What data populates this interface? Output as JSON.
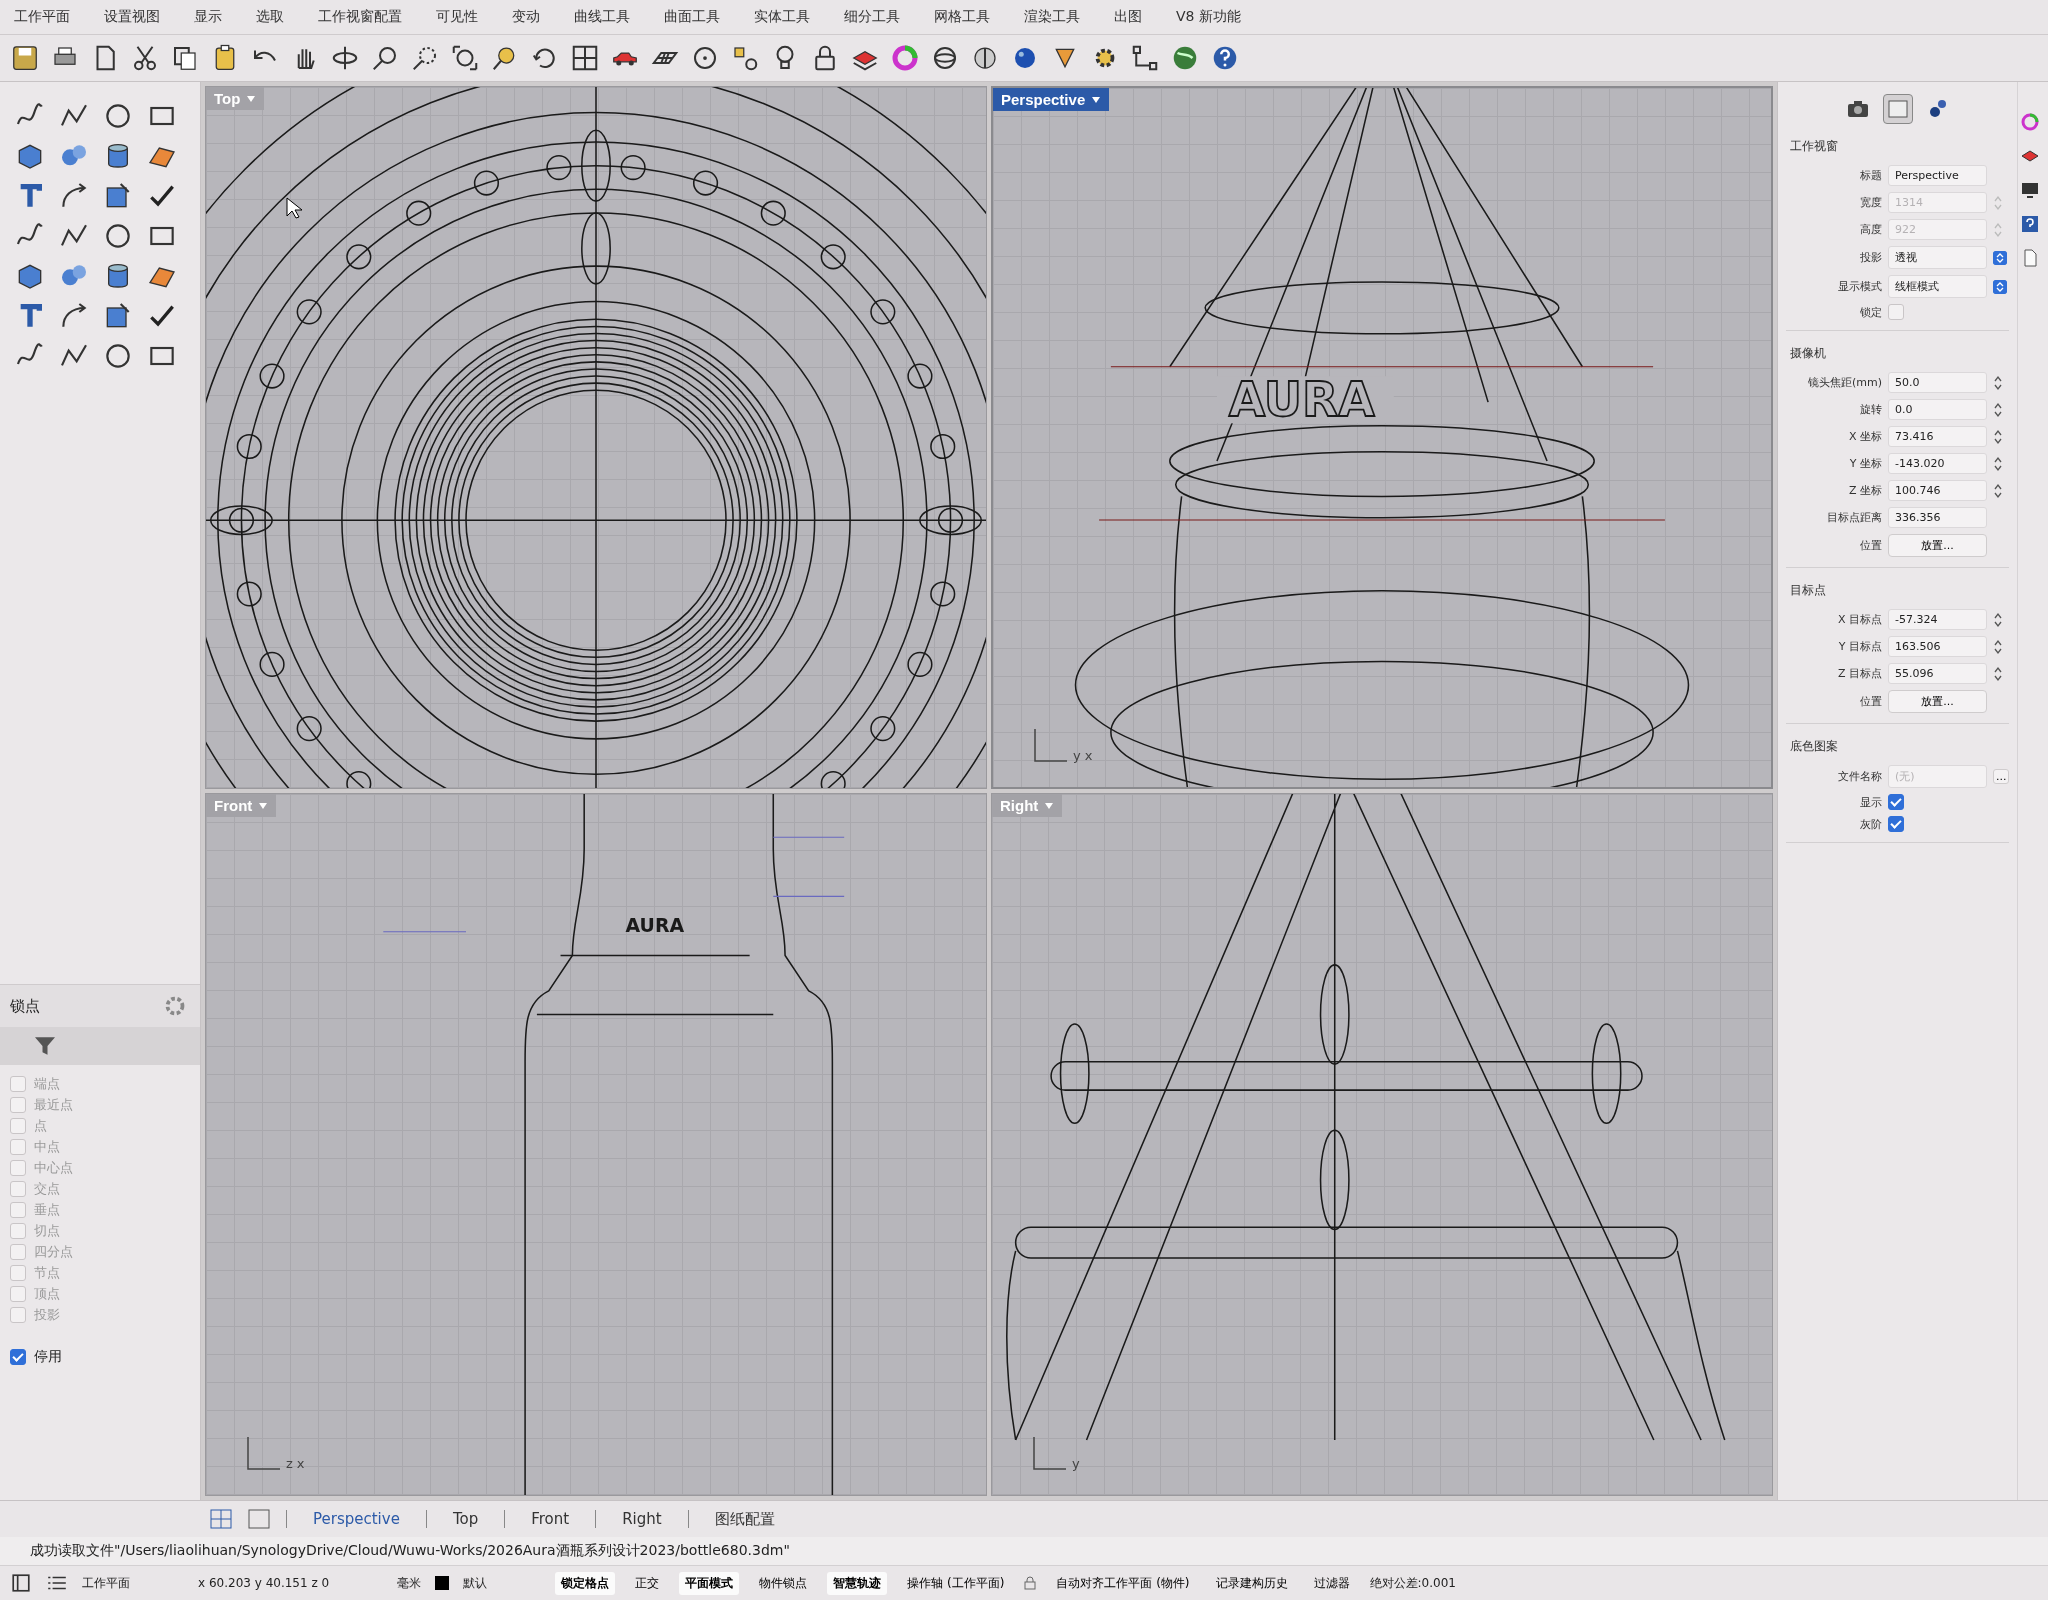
{
  "menu": [
    "工作平面",
    "设置视图",
    "显示",
    "选取",
    "工作视窗配置",
    "可见性",
    "变动",
    "曲线工具",
    "曲面工具",
    "实体工具",
    "细分工具",
    "网格工具",
    "渲染工具",
    "出图",
    "V8 新功能"
  ],
  "viewports": [
    {
      "title": "Top",
      "selected": false,
      "kind": "top"
    },
    {
      "title": "Perspective",
      "selected": true,
      "kind": "perspective",
      "axes": [
        "y",
        "x"
      ],
      "model_text": "AURA"
    },
    {
      "title": "Front",
      "selected": false,
      "kind": "front",
      "axes": [
        "z",
        "x"
      ],
      "model_text": "AURA"
    },
    {
      "title": "Right",
      "selected": false,
      "kind": "right",
      "axes": [
        "y"
      ]
    }
  ],
  "osnap": {
    "title": "锁点",
    "items": [
      {
        "label": "端点",
        "checked": false
      },
      {
        "label": "最近点",
        "checked": false
      },
      {
        "label": "点",
        "checked": false
      },
      {
        "label": "中点",
        "checked": false
      },
      {
        "label": "中心点",
        "checked": false
      },
      {
        "label": "交点",
        "checked": false
      },
      {
        "label": "垂点",
        "checked": false
      },
      {
        "label": "切点",
        "checked": false
      },
      {
        "label": "四分点",
        "checked": false
      },
      {
        "label": "节点",
        "checked": false
      },
      {
        "label": "顶点",
        "checked": false
      },
      {
        "label": "投影",
        "checked": false
      }
    ],
    "disable": {
      "label": "停用",
      "checked": true
    }
  },
  "panel_tabs": [
    {
      "selected": false
    },
    {
      "selected": true
    },
    {
      "selected": false
    }
  ],
  "properties": [
    {
      "title": "工作视窗",
      "rows": [
        {
          "kind": "text",
          "label": "标题",
          "value": "Perspective",
          "disabled": false
        },
        {
          "kind": "spin",
          "label": "宽度",
          "value": "1314",
          "disabled": true
        },
        {
          "kind": "spin",
          "label": "高度",
          "value": "922",
          "disabled": true
        },
        {
          "kind": "select",
          "label": "投影",
          "value": "透视"
        },
        {
          "kind": "select",
          "label": "显示模式",
          "value": "线框模式"
        },
        {
          "kind": "check",
          "label": "锁定",
          "checked": false
        }
      ]
    },
    {
      "title": "摄像机",
      "rows": [
        {
          "kind": "spin",
          "label": "镜头焦距(mm)",
          "value": "50.0",
          "disabled": false
        },
        {
          "kind": "spin",
          "label": "旋转",
          "value": "0.0",
          "disabled": false
        },
        {
          "kind": "spin",
          "label": "X 坐标",
          "value": "73.416",
          "disabled": false
        },
        {
          "kind": "spin",
          "label": "Y 坐标",
          "value": "-143.020",
          "disabled": false
        },
        {
          "kind": "spin",
          "label": "Z 坐标",
          "value": "100.746",
          "disabled": false
        },
        {
          "kind": "text",
          "label": "目标点距离",
          "value": "336.356",
          "disabled": false
        },
        {
          "kind": "button",
          "label": "位置",
          "value": "放置..."
        }
      ]
    },
    {
      "title": "目标点",
      "rows": [
        {
          "kind": "spin",
          "label": "X 目标点",
          "value": "-57.324",
          "disabled": false
        },
        {
          "kind": "spin",
          "label": "Y 目标点",
          "value": "163.506",
          "disabled": false
        },
        {
          "kind": "spin",
          "label": "Z 目标点",
          "value": "55.096",
          "disabled": false
        },
        {
          "kind": "button",
          "label": "位置",
          "value": "放置..."
        }
      ]
    },
    {
      "title": "底色图案",
      "rows": [
        {
          "kind": "file",
          "label": "文件名称",
          "value": "(无)",
          "button": "..."
        },
        {
          "kind": "check",
          "label": "显示",
          "checked": true
        },
        {
          "kind": "check",
          "label": "灰阶",
          "checked": true
        }
      ]
    }
  ],
  "viewport_tabs": [
    {
      "label": "Perspective",
      "selected": true
    },
    {
      "label": "Top",
      "selected": false
    },
    {
      "label": "Front",
      "selected": false
    },
    {
      "label": "Right",
      "selected": false
    },
    {
      "label": "图纸配置",
      "selected": false
    }
  ],
  "command_history": "成功读取文件\"/Users/liaolihuan/SynologyDrive/Cloud/Wuwu-Works/2026Aura酒瓶系列设计2023/bottle680.3dm\"",
  "status": {
    "cplane": "工作平面",
    "coords": "x 60.203  y 40.151  z 0",
    "units": "毫米",
    "layer": "默认",
    "toggles": [
      {
        "label": "锁定格点",
        "on": true,
        "kind": "plain"
      },
      {
        "label": "正交",
        "on": false,
        "kind": "plain"
      },
      {
        "label": "平面模式",
        "on": true,
        "kind": "plain"
      },
      {
        "label": "物件锁点",
        "on": false,
        "kind": "plain"
      },
      {
        "label": "智慧轨迹",
        "on": true,
        "kind": "plain"
      },
      {
        "label": "操作轴 (工作平面)",
        "on": false,
        "kind": "plain"
      },
      {
        "label": "自动对齐工作平面 (物件)",
        "on": false,
        "kind": "lock"
      },
      {
        "label": "记录建构历史",
        "on": false,
        "kind": "plain"
      },
      {
        "label": "过滤器",
        "on": false,
        "kind": "plain"
      }
    ],
    "tolerance": "绝对公差:0.001"
  }
}
